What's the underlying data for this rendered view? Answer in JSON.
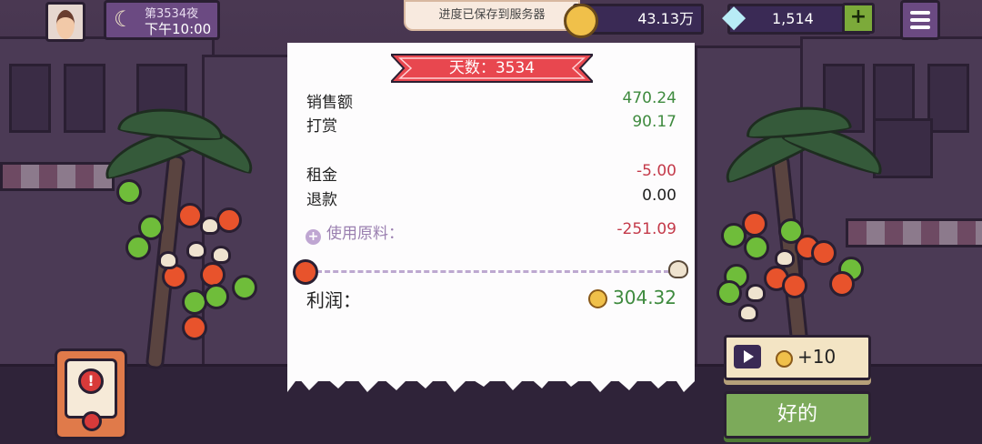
{
  "top_bar": {
    "night_label": "第3534夜",
    "time_label": "下午10:00",
    "save_toast": "进度已保存到服务器",
    "coins": "43.13万",
    "gems": "1,514",
    "add_label": "+"
  },
  "receipt": {
    "day_banner": "天数：3534",
    "sales_label": "销售额",
    "sales_value": "470.24",
    "tips_label": "打赏",
    "tips_value": "90.17",
    "rent_label": "租金",
    "rent_value": "-5.00",
    "refund_label": "退款",
    "refund_value": "0.00",
    "ingredients_label": "使用原料：",
    "ingredients_value": "-251.09",
    "profit_label": "利润：",
    "profit_value": "304.32"
  },
  "buttons": {
    "ad_reward_label": "+10",
    "ok_label": "好的"
  },
  "colors": {
    "positive": "#3e8a3e",
    "negative": "#c43a4a",
    "banner": "#e8474f",
    "button_green": "#7caa5a"
  },
  "icons": [
    "moon-icon",
    "coin-icon",
    "diamond-icon",
    "menu-icon",
    "play-video-icon",
    "alert-icon",
    "plus-circle-icon"
  ]
}
